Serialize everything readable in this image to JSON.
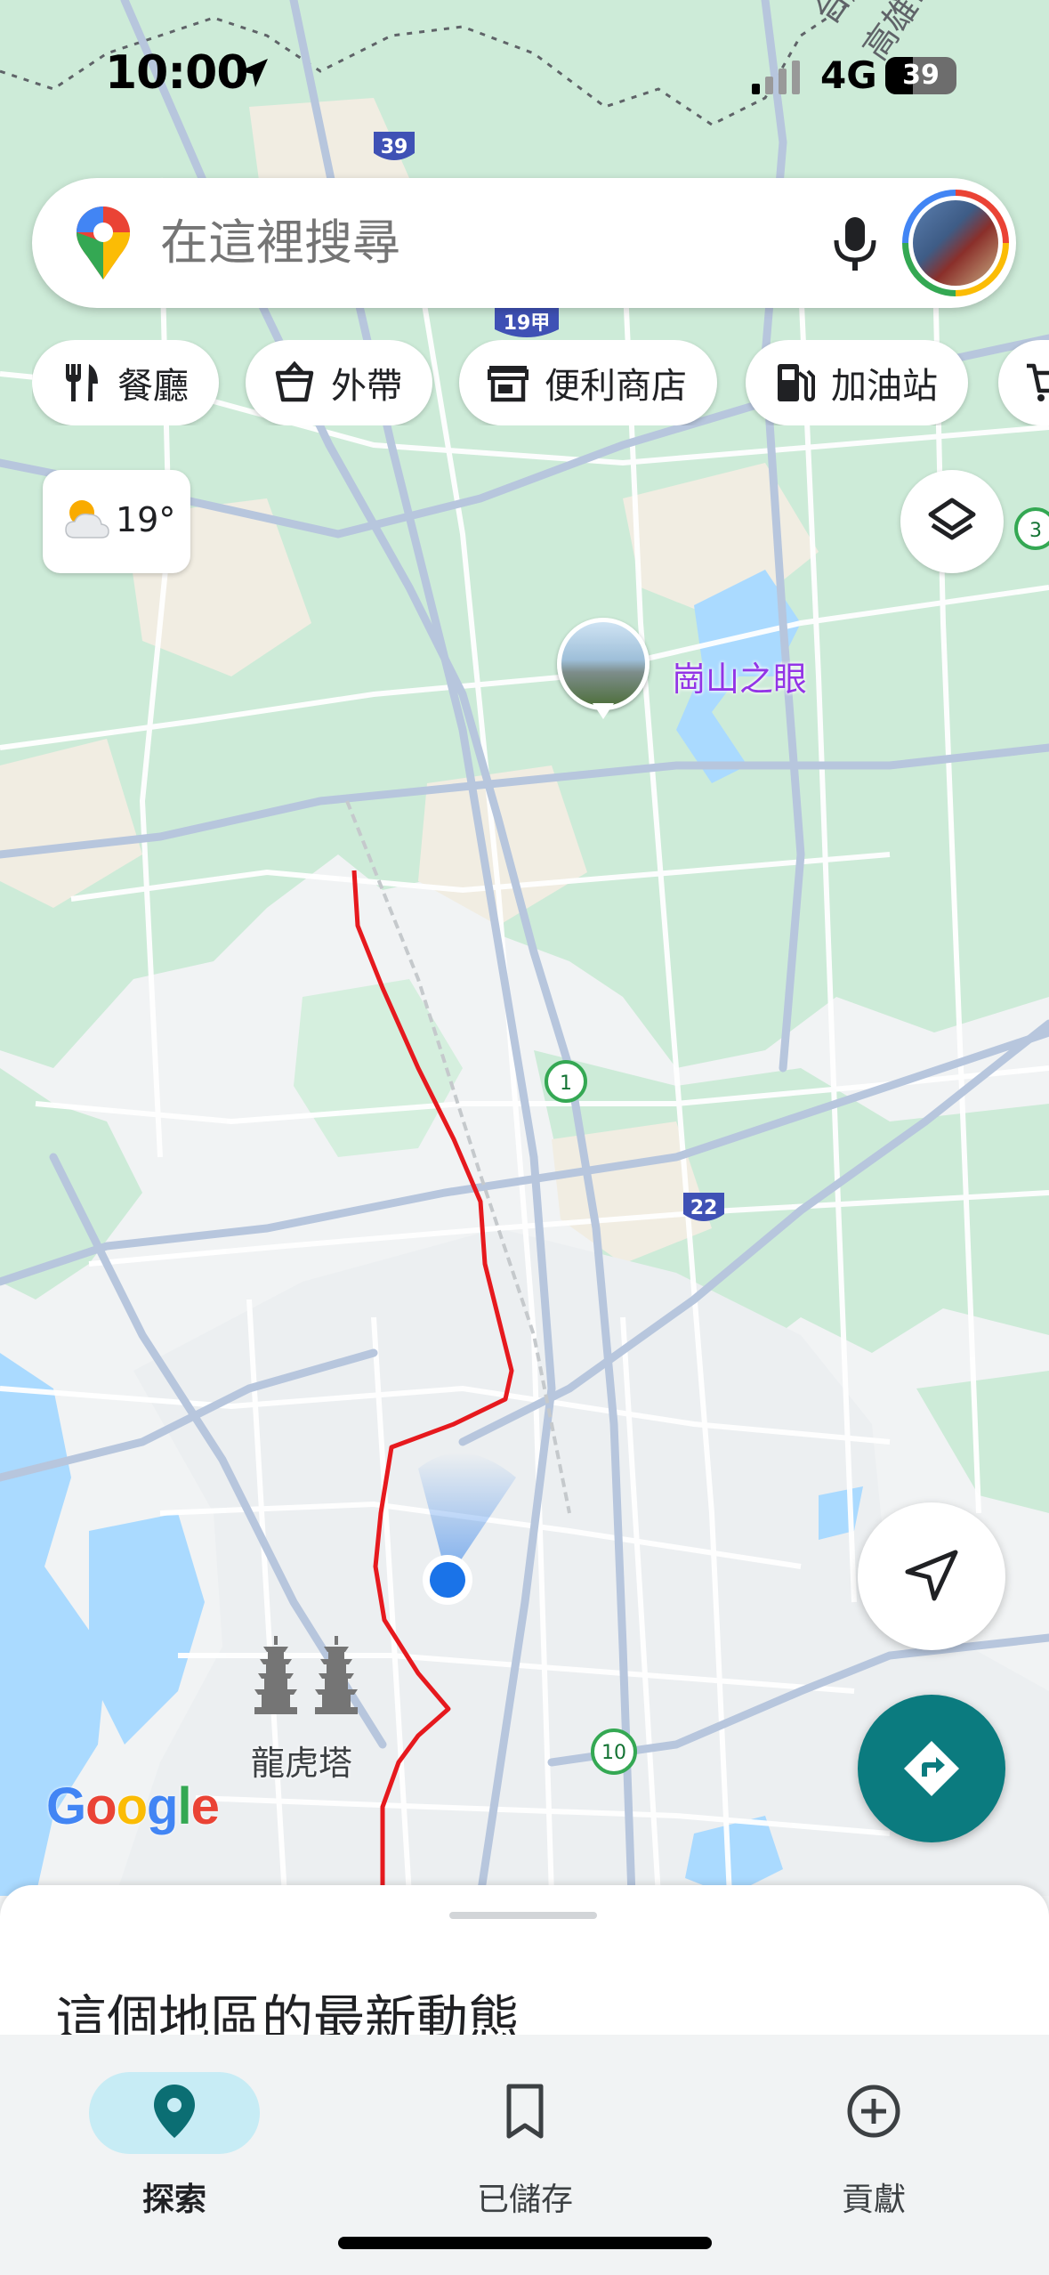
{
  "status_bar": {
    "time": "10:00",
    "network": "4G",
    "battery": "39",
    "battery_level": 0.39
  },
  "search": {
    "placeholder": "在這裡搜尋",
    "icons": {
      "left": "google-maps-pin-icon",
      "voice": "mic-icon",
      "account": "avatar"
    }
  },
  "chips": [
    {
      "label": "餐廳",
      "icon": "restaurant-icon"
    },
    {
      "label": "外帶",
      "icon": "takeout-icon"
    },
    {
      "label": "便利商店",
      "icon": "store-icon"
    },
    {
      "label": "加油站",
      "icon": "gas-station-icon"
    },
    {
      "label": "",
      "icon": "cart-icon"
    }
  ],
  "weather": {
    "temp": "19°",
    "icon": "partly-cloudy-icon"
  },
  "map": {
    "poi": {
      "name": "崗山之眼"
    },
    "landmark": {
      "name": "龍虎塔"
    },
    "attribution": "Google",
    "route_color": "#e6191e",
    "road_shields": [
      "39",
      "19甲",
      "1",
      "22",
      "10",
      "3"
    ],
    "region_labels": [
      "台南市",
      "高雄市"
    ]
  },
  "sheet": {
    "title": "這個地區的最新動態"
  },
  "nav": [
    {
      "label": "探索",
      "icon": "explore-pin-icon",
      "active": true
    },
    {
      "label": "已儲存",
      "icon": "bookmark-icon",
      "active": false
    },
    {
      "label": "貢獻",
      "icon": "add-circle-icon",
      "active": false
    }
  ],
  "colors": {
    "accent": "#0b7b7f",
    "map_green": "#c9ebd5",
    "water": "#aadaff",
    "location_dot": "#1a73e8",
    "active_tab_pill": "#c7ecf5"
  }
}
